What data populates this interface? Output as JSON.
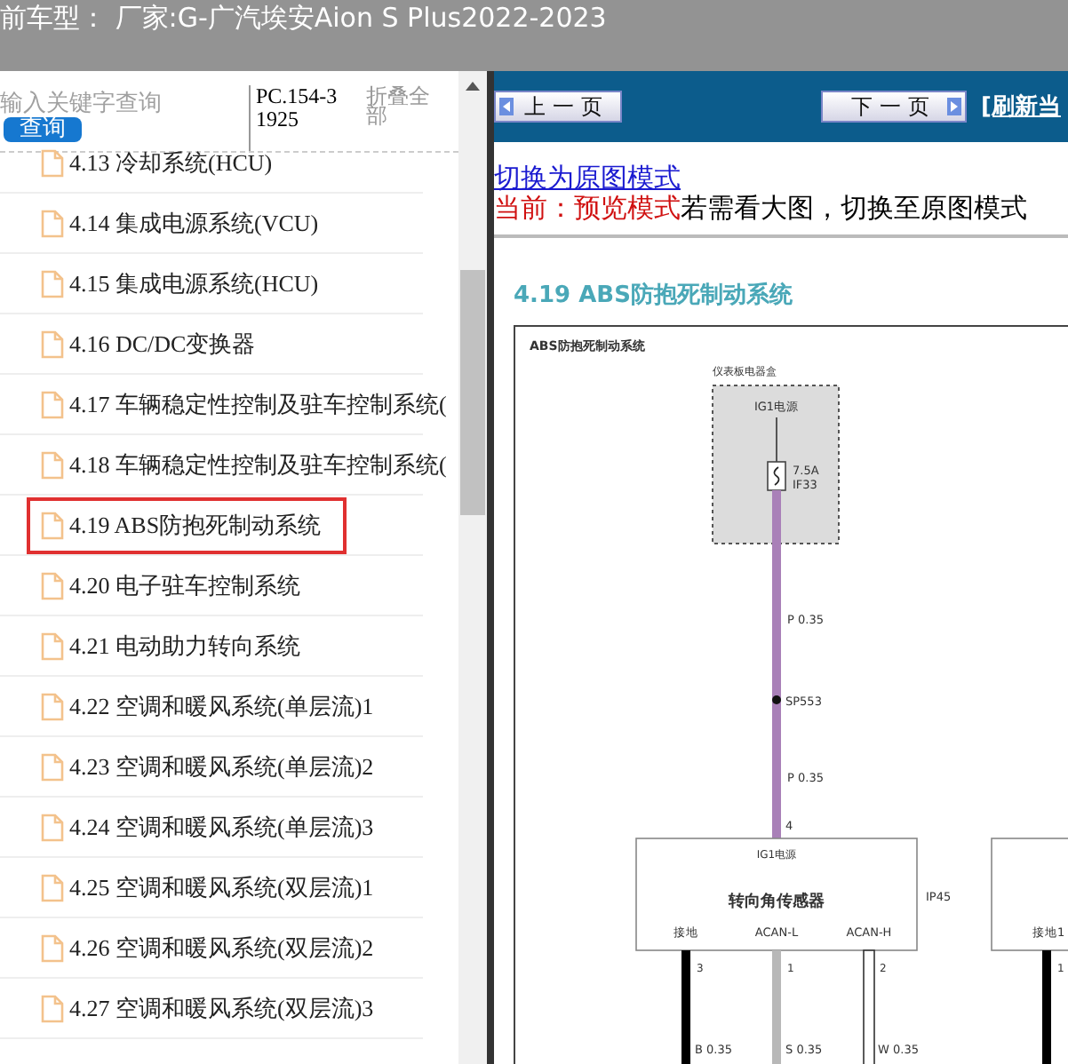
{
  "header": {
    "title": "前车型： 厂家:G-广汽埃安Aion S Plus2022-2023"
  },
  "sidebar": {
    "search": {
      "placeholder": "输入关键字查询",
      "button": "查询"
    },
    "code": "PC.154-31925",
    "collapse_all": "折叠全部",
    "items": [
      {
        "label": "4.13 冷却系统(HCU)",
        "selected": false
      },
      {
        "label": "4.14 集成电源系统(VCU)",
        "selected": false
      },
      {
        "label": "4.15 集成电源系统(HCU)",
        "selected": false
      },
      {
        "label": "4.16 DC/DC变换器",
        "selected": false
      },
      {
        "label": "4.17 车辆稳定性控制及驻车控制系统(",
        "selected": false
      },
      {
        "label": "4.18 车辆稳定性控制及驻车控制系统(",
        "selected": false
      },
      {
        "label": "4.19 ABS防抱死制动系统",
        "selected": true
      },
      {
        "label": "4.20 电子驻车控制系统",
        "selected": false
      },
      {
        "label": "4.21 电动助力转向系统",
        "selected": false
      },
      {
        "label": "4.22 空调和暖风系统(单层流)1",
        "selected": false
      },
      {
        "label": "4.23 空调和暖风系统(单层流)2",
        "selected": false
      },
      {
        "label": "4.24 空调和暖风系统(单层流)3",
        "selected": false
      },
      {
        "label": "4.25 空调和暖风系统(双层流)1",
        "selected": false
      },
      {
        "label": "4.26 空调和暖风系统(双层流)2",
        "selected": false
      },
      {
        "label": "4.27 空调和暖风系统(双层流)3",
        "selected": false
      }
    ]
  },
  "content": {
    "prev_button": "上一页",
    "next_button": "下一页",
    "refresh_link": "[刷新当",
    "mode_link": "切换为原图模式",
    "status_current": "当前：预览模式",
    "status_hint": "若需看大图，切换至原图模式",
    "section_title": "4.19 ABS防抱死制动系统",
    "diagram": {
      "title": "ABS防抱死制动系统",
      "fuse_box_label": "仪表板电器盒",
      "power_label": "IG1电源",
      "fuse_rating": "7.5A",
      "fuse_id": "IF33",
      "wire_label_upper": "P 0.35",
      "splice_label": "SP553",
      "wire_label_lower": "P 0.35",
      "pin_label": "4",
      "sensor": {
        "power_label": "IG1电源",
        "name": "转向角传感器",
        "connector": "IP45",
        "pins": [
          {
            "label": "接地",
            "number": "3",
            "wire": "B 0.35",
            "color": "#000000"
          },
          {
            "label": "ACAN-L",
            "number": "1",
            "wire": "S 0.35",
            "color": "#b8b8b8"
          },
          {
            "label": "ACAN-H",
            "number": "2",
            "wire": "W 0.35",
            "color": "#ffffff"
          }
        ]
      },
      "ground_module": {
        "pin_label": "接地1",
        "number": "1"
      }
    }
  }
}
